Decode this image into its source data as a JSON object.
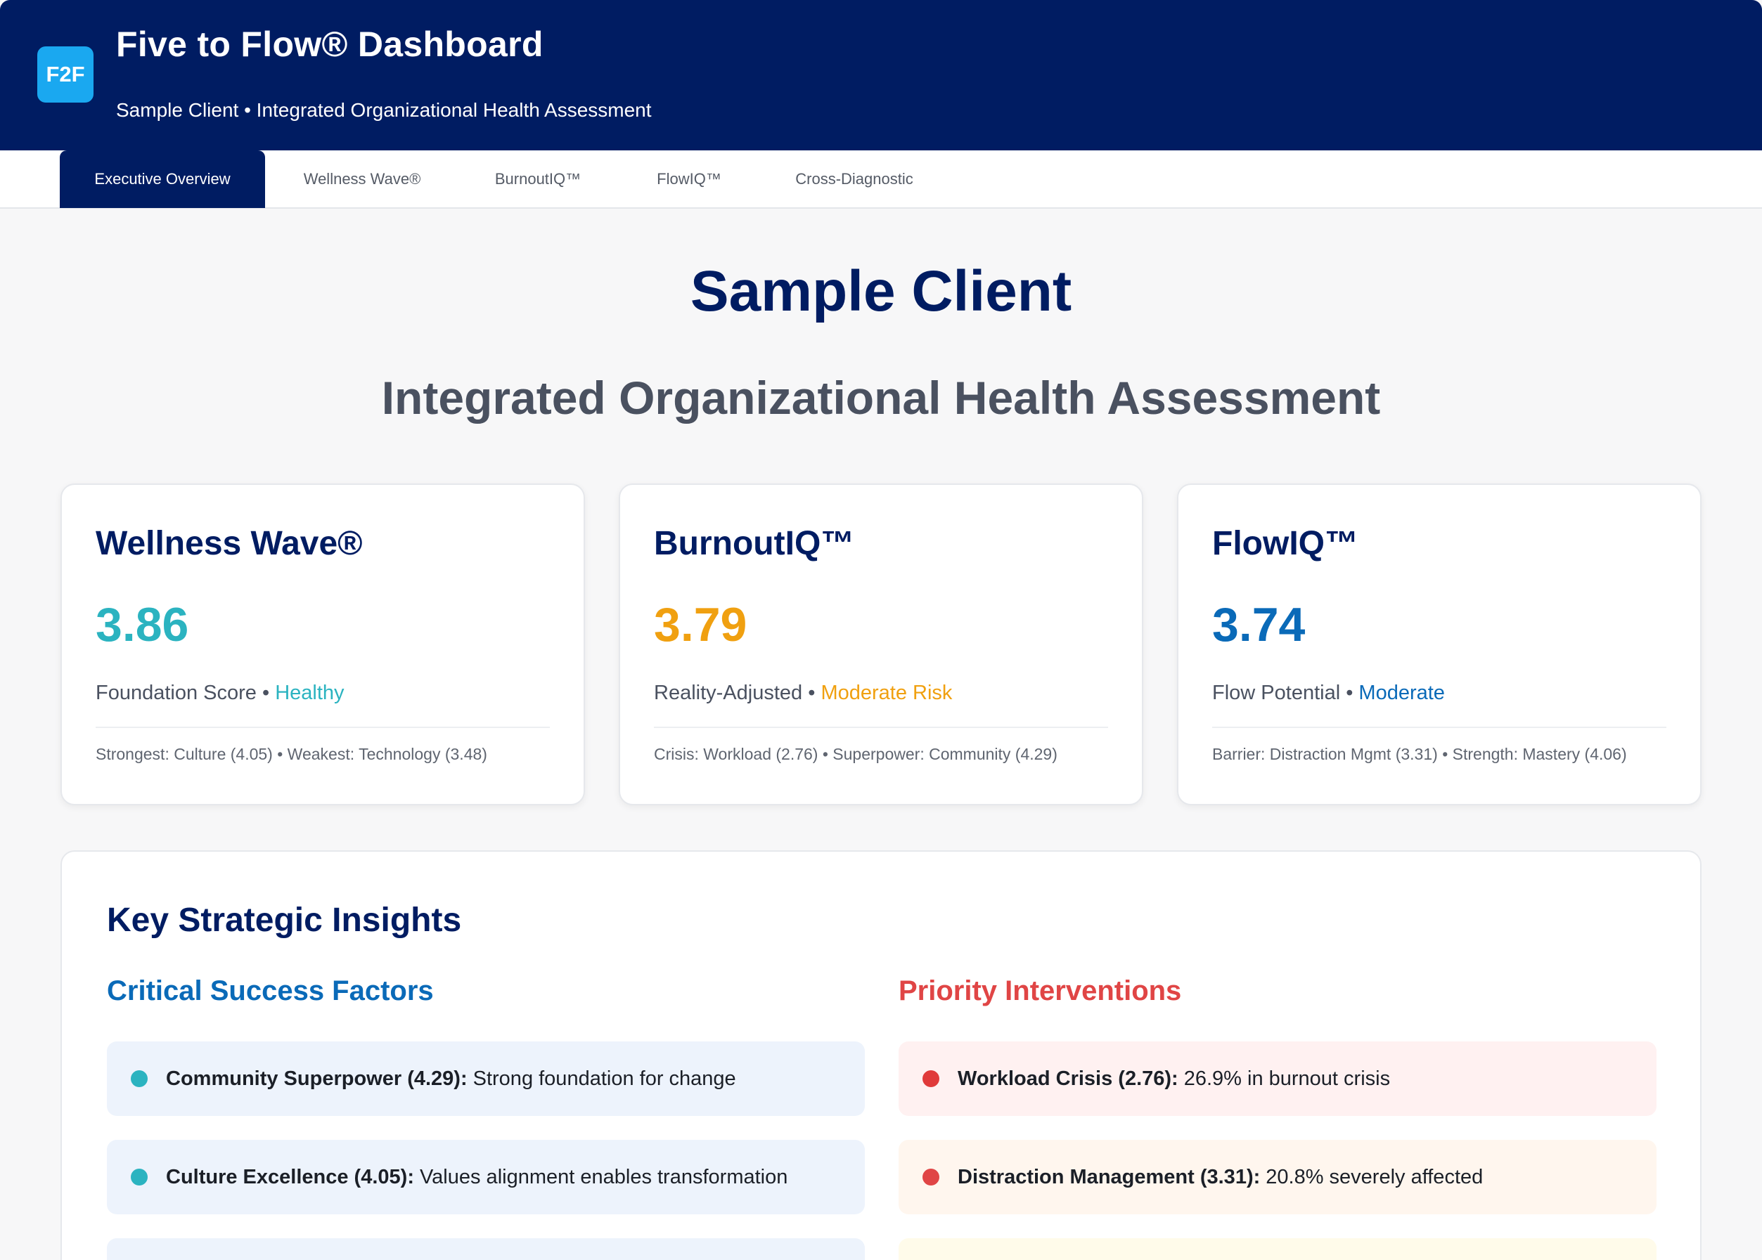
{
  "header": {
    "logo": "F2F",
    "title": "Five to Flow® Dashboard",
    "subtitle": "Sample Client • Integrated Organizational Health Assessment"
  },
  "tabs": [
    {
      "label": "Executive Overview",
      "active": true
    },
    {
      "label": "Wellness Wave®",
      "active": false
    },
    {
      "label": "BurnoutIQ™",
      "active": false
    },
    {
      "label": "FlowIQ™",
      "active": false
    },
    {
      "label": "Cross-Diagnostic",
      "active": false
    }
  ],
  "page": {
    "client_name": "Sample Client",
    "assessment_title": "Integrated Organizational Health Assessment"
  },
  "cards": [
    {
      "title": "Wellness Wave®",
      "score": "3.86",
      "score_color": "#2bb3c0",
      "status_label": "Foundation Score •",
      "status_value": "Healthy",
      "detail": "Strongest: Culture (4.05) • Weakest: Technology (3.48)"
    },
    {
      "title": "BurnoutIQ™",
      "score": "3.79",
      "score_color": "#f0a010",
      "status_label": "Reality-Adjusted •",
      "status_value": "Moderate Risk",
      "detail": "Crisis: Workload (2.76) • Superpower: Community (4.29)"
    },
    {
      "title": "FlowIQ™",
      "score": "3.74",
      "score_color": "#0a6ab8",
      "status_label": "Flow Potential •",
      "status_value": "Moderate",
      "detail": "Barrier: Distraction Mgmt (3.31) • Strength: Mastery (4.06)"
    }
  ],
  "insights": {
    "title": "Key Strategic Insights",
    "success": {
      "title": "Critical Success Factors",
      "color": "#0a6ab8",
      "items": [
        {
          "label": "Community Superpower (4.29):",
          "text": "Strong foundation for change"
        },
        {
          "label": "Culture Excellence (4.05):",
          "text": "Values alignment enables transformation"
        }
      ]
    },
    "priority": {
      "title": "Priority Interventions",
      "color": "#e04545",
      "items": [
        {
          "label": "Workload Crisis (2.76):",
          "text": "26.9% in burnout crisis"
        },
        {
          "label": "Distraction Management (3.31):",
          "text": "20.8% severely affected"
        }
      ]
    }
  },
  "colors": {
    "navy": "#001c62",
    "teal_dot": "#2bb3c0",
    "red_dot": "#e03a3a"
  }
}
